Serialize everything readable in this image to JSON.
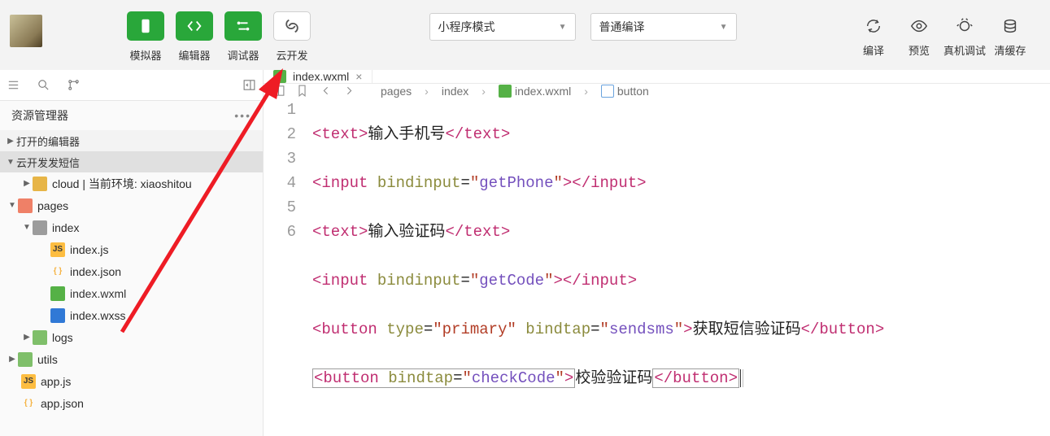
{
  "toolbar": {
    "simulator": "模拟器",
    "editor": "编辑器",
    "debugger": "调试器",
    "cloud": "云开发",
    "compile": "编译",
    "preview": "预览",
    "realDevice": "真机调试",
    "clearCache": "清缓存"
  },
  "dropdowns": {
    "mode": "小程序模式",
    "compileMode": "普通编译"
  },
  "sidebar": {
    "title": "资源管理器",
    "openEditors": "打开的编辑器",
    "project": "云开发发短信",
    "cloud": "cloud | 当前环境: xiaoshitou",
    "pages": "pages",
    "index": "index",
    "files": {
      "indexjs": "index.js",
      "indexjson": "index.json",
      "indexwxml": "index.wxml",
      "indexwxss": "index.wxss"
    },
    "logs": "logs",
    "utils": "utils",
    "appjs": "app.js",
    "appjson": "app.json"
  },
  "tab": {
    "name": "index.wxml"
  },
  "breadcrumb": {
    "p1": "pages",
    "p2": "index",
    "p3": "index.wxml",
    "p4": "button"
  },
  "code": {
    "l1": {
      "t1": "text",
      "txt": "输入手机号",
      "t2": "text"
    },
    "l2": {
      "t1": "input",
      "a1": "bindinput",
      "v1": "getPhone",
      "t2": "input"
    },
    "l3": {
      "t1": "text",
      "txt": "输入验证码",
      "t2": "text"
    },
    "l4": {
      "t1": "input",
      "a1": "bindinput",
      "v1": "getCode",
      "t2": "input"
    },
    "l5": {
      "t1": "button",
      "a1": "type",
      "v1": "primary",
      "a2": "bindtap",
      "v2": "sendsms",
      "txt": "获取短信验证码",
      "t2": "button"
    },
    "l6": {
      "t1": "button",
      "a1": "bindtap",
      "v1": "checkCode",
      "txt": "校验验证码",
      "t2": "button"
    },
    "nums": {
      "n1": "1",
      "n2": "2",
      "n3": "3",
      "n4": "4",
      "n5": "5",
      "n6": "6"
    }
  }
}
